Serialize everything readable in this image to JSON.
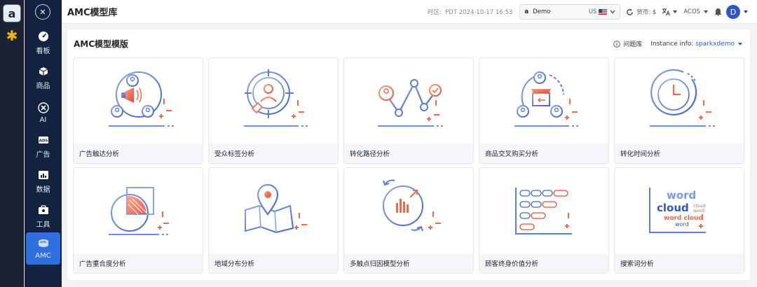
{
  "header": {
    "page_title": "AMC模型库",
    "timezone_label": "时区:",
    "timezone_value": "PDT 2024-10-17 16:53",
    "store_marker": "a",
    "store_name": "Demo",
    "country": "US",
    "currency_label": "货币: $",
    "metric": "ACOS",
    "avatar": "D"
  },
  "rail": {
    "amazon": "a"
  },
  "sidebar": {
    "items": [
      {
        "label": "看板",
        "icon": "gauge-icon"
      },
      {
        "label": "商品",
        "icon": "boxes-icon"
      },
      {
        "label": "AI",
        "icon": "ai-icon"
      },
      {
        "label": "广告",
        "icon": "ads-icon"
      },
      {
        "label": "数据",
        "icon": "data-icon"
      },
      {
        "label": "工具",
        "icon": "toolbox-icon"
      },
      {
        "label": "AMC",
        "icon": "amc-icon"
      }
    ]
  },
  "panel": {
    "title": "AMC模型模版",
    "question_bank": "问题库",
    "instance_label": "Instance info:",
    "instance_value": "sparkxdemo"
  },
  "cards": [
    {
      "label": "广告触达分析"
    },
    {
      "label": "受众标签分析"
    },
    {
      "label": "转化路径分析"
    },
    {
      "label": "商品交叉购买分析"
    },
    {
      "label": "转化时间分析"
    },
    {
      "label": "广告重合度分析"
    },
    {
      "label": "地域分布分析"
    },
    {
      "label": "多触点归因模型分析"
    },
    {
      "label": "顾客终身价值分析"
    },
    {
      "label": "搜索词分析"
    }
  ],
  "wordcloud": {
    "w1": "word",
    "w2": "cloud",
    "w3": "cloud",
    "w4": "word",
    "w5": "word cloud",
    "w6": "word"
  },
  "colors": {
    "accent": "#2f6fe0",
    "sidebar": "#13233f",
    "illustration_blue": "#5b7fd6",
    "illustration_red": "#f0684f"
  }
}
